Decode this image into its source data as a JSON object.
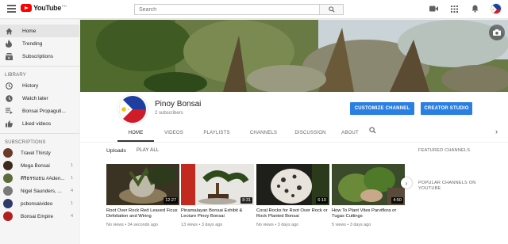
{
  "app": {
    "logo_text": "YouTube",
    "logo_sup": "PH"
  },
  "search": {
    "placeholder": "Search"
  },
  "sidebar": {
    "main": [
      {
        "label": "Home",
        "icon": "home-icon"
      },
      {
        "label": "Trending",
        "icon": "trending-icon"
      },
      {
        "label": "Subscriptions",
        "icon": "subscriptions-icon"
      }
    ],
    "library_heading": "LIBRARY",
    "library": [
      {
        "label": "History",
        "icon": "history-icon"
      },
      {
        "label": "Watch later",
        "icon": "watch-later-icon"
      },
      {
        "label": "Bonsai Propaguti...",
        "icon": "playlist-icon"
      },
      {
        "label": "Liked videos",
        "icon": "liked-icon"
      }
    ],
    "subscriptions_heading": "SUBSCRIPTIONS",
    "subscriptions": [
      {
        "label": "Travel Thirsty",
        "count": "",
        "color": "#6b3a2a"
      },
      {
        "label": "Mega Bonsai",
        "count": "1",
        "color": "#3b2a1c"
      },
      {
        "label": "ศิริธรรมธน #Aden...",
        "count": "1",
        "color": "#5d6a3a"
      },
      {
        "label": "Nigel Saunders, ...",
        "count": "4",
        "color": "#7a7a7a"
      },
      {
        "label": "pcbonsaivideo",
        "count": "1",
        "color": "#2d3a6a"
      },
      {
        "label": "Bonsai Empire",
        "count": "4",
        "color": "#b02020"
      }
    ]
  },
  "channel": {
    "name": "Pinoy Bonsai",
    "subscribers": "2 subscribers",
    "customize_label": "CUSTOMIZE CHANNEL",
    "studio_label": "CREATOR STUDIO"
  },
  "tabs": [
    "HOME",
    "VIDEOS",
    "PLAYLISTS",
    "CHANNELS",
    "DISCUSSION",
    "ABOUT"
  ],
  "uploads": {
    "title": "Uploads",
    "play_all": "PLAY ALL",
    "videos": [
      {
        "title": "Root Over Rock Red Leaved Ficus Defoliation and Wiring",
        "meta": "No views • 34 seconds ago",
        "duration": "12:27"
      },
      {
        "title": "Pinamalayan Bonsai Exhibit & Lecture Pinoy Bonsai",
        "meta": "13 views • 3 days ago",
        "duration": "8:31"
      },
      {
        "title": "Coral Rocks for Root Over Rock or Rock Planted Bonsai",
        "meta": "No views • 3 days ago",
        "duration": "6:10"
      },
      {
        "title": "How To Plant Vitex Parviflora or Tugas Cuttings",
        "meta": "5 views • 3 days ago",
        "duration": "4:50"
      }
    ]
  },
  "right_column": {
    "featured": "FEATURED CHANNELS",
    "popular": "POPULAR CHANNELS ON YOUTUBE"
  },
  "colors": {
    "accent_blue": "#2a7fe3",
    "youtube_red": "#ff0000"
  }
}
